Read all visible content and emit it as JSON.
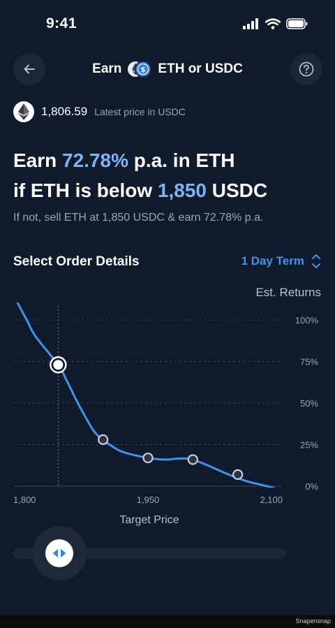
{
  "status_bar": {
    "time": "9:41"
  },
  "nav": {
    "title_prefix": "Earn",
    "title_suffix": "ETH or USDC",
    "back_icon": "arrow-left-icon",
    "help_icon": "question-icon"
  },
  "price": {
    "value": "1,806.59",
    "caption": "Latest price in USDC",
    "icon": "ethereum-icon"
  },
  "headline": {
    "line1_prefix": "Earn",
    "apy": "72.78%",
    "line1_suffix": "p.a. in ETH",
    "line2_prefix": "if ETH is below",
    "strike": "1,850",
    "line2_suffix": "USDC"
  },
  "subline": "If not, sell ETH at 1,850 USDC & earn 72.78% p.a.",
  "order": {
    "title": "Select Order Details",
    "term": "1 Day Term"
  },
  "est_returns_label": "Est. Returns",
  "colors": {
    "background": "#0f1a2c",
    "accent": "#3d95ec",
    "highlight": "#7cb4f4",
    "muted": "#9aa5b8"
  },
  "chart_data": {
    "type": "line",
    "xlabel": "Target Price",
    "x_tick_labels": [
      "1,800",
      "1,950",
      "2,100"
    ],
    "y_tick_labels": [
      "100%",
      "75%",
      "50%",
      "25%",
      "0%"
    ],
    "xlim": [
      1800,
      2100
    ],
    "ylim": [
      0,
      100
    ],
    "grid": true,
    "series": [
      {
        "x": [
          1805,
          1815,
          1825,
          1850,
          1860,
          1870,
          1880,
          1890,
          1900,
          1920,
          1950,
          1970,
          1980,
          1995,
          2010,
          2025,
          2040,
          2060,
          2075,
          2090
        ],
        "y": [
          110,
          100,
          90,
          73,
          63,
          52,
          42,
          33,
          28,
          21,
          17,
          16,
          16.5,
          16.5,
          14,
          10.5,
          7,
          3,
          1,
          -1
        ]
      }
    ],
    "markers": [
      {
        "x": 1850,
        "y": 73,
        "selected": true
      },
      {
        "x": 1900,
        "y": 28
      },
      {
        "x": 1950,
        "y": 17
      },
      {
        "x": 2000,
        "y": 16
      },
      {
        "x": 2050,
        "y": 7
      }
    ],
    "selected_x": 1850
  },
  "slider": {
    "knob_icon": "left-right-arrows-icon"
  },
  "watermark": "Snapensnap"
}
